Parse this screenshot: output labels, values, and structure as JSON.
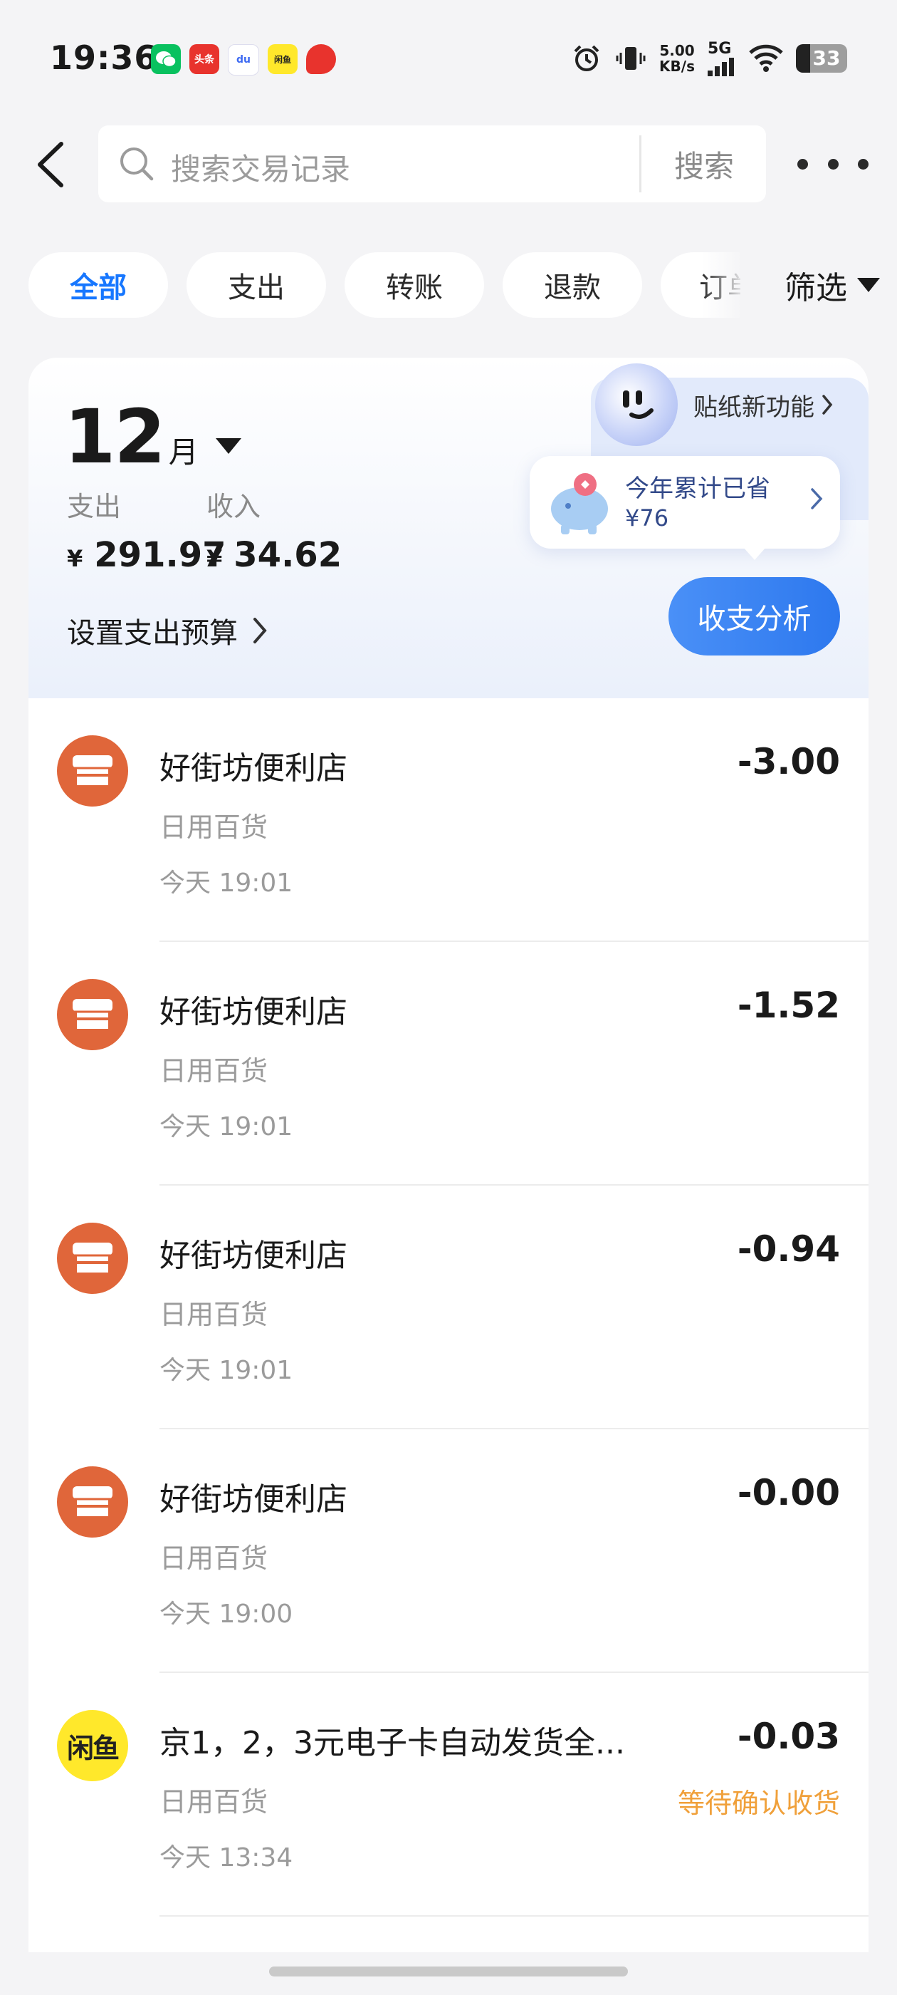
{
  "status_bar": {
    "time": "19:36",
    "net_speed_value": "5.00",
    "net_speed_unit": "KB/s",
    "network": "5G",
    "battery": "33",
    "notifications": [
      {
        "name": "wechat-notif-icon",
        "label": "",
        "color": "#09c15f"
      },
      {
        "name": "toutiao-notif-icon",
        "label": "头条",
        "color": "#e8332d"
      },
      {
        "name": "baidu-notif-icon",
        "label": "du",
        "color": "#3d6af2"
      },
      {
        "name": "xianyu-notif-icon",
        "label": "闲鱼",
        "color": "#ffe82b"
      },
      {
        "name": "app-notif-icon",
        "label": "",
        "color": "#e8332d"
      }
    ]
  },
  "search": {
    "placeholder": "搜索交易记录",
    "button": "搜索"
  },
  "tabs": [
    {
      "label": "全部",
      "active": true
    },
    {
      "label": "支出",
      "active": false
    },
    {
      "label": "转账",
      "active": false
    },
    {
      "label": "退款",
      "active": false
    },
    {
      "label": "订单",
      "active": false
    }
  ],
  "filter_label": "筛选",
  "summary": {
    "month_num": "12",
    "month_unit": "月",
    "expense_label": "支出",
    "expense_currency": "¥",
    "expense_value": "291.97",
    "income_label": "收入",
    "income_currency": "¥",
    "income_value": "34.62",
    "budget_label": "设置支出预算",
    "analysis_button": "收支分析",
    "sticker_label": "贴纸新功能",
    "saved_title": "今年累计已省",
    "saved_amount": "¥76"
  },
  "transactions": [
    {
      "icon": "store",
      "name": "好街坊便利店",
      "category": "日用百货",
      "time": "今天 19:01",
      "amount": "-3.00",
      "status": ""
    },
    {
      "icon": "store",
      "name": "好街坊便利店",
      "category": "日用百货",
      "time": "今天 19:01",
      "amount": "-1.52",
      "status": ""
    },
    {
      "icon": "store",
      "name": "好街坊便利店",
      "category": "日用百货",
      "time": "今天 19:01",
      "amount": "-0.94",
      "status": ""
    },
    {
      "icon": "store",
      "name": "好街坊便利店",
      "category": "日用百货",
      "time": "今天 19:00",
      "amount": "-0.00",
      "status": ""
    },
    {
      "icon": "xianyu",
      "icon_text": "闲鱼",
      "name": "京1，2，3元电子卡自动发货全...",
      "category": "日用百货",
      "time": "今天 13:34",
      "amount": "-0.03",
      "status": "等待确认收货"
    }
  ],
  "colors": {
    "accent": "#1777ff",
    "store_icon": "#e0663a",
    "xianyu_icon": "#ffe82b",
    "pending_status": "#f0a03a"
  }
}
